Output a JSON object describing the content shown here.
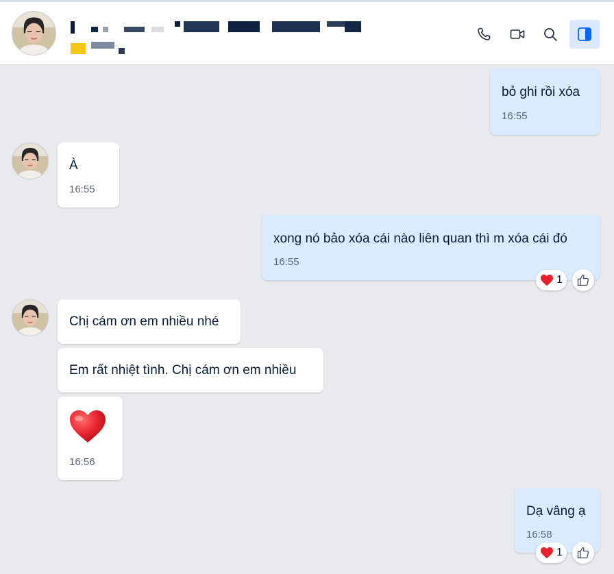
{
  "header": {
    "contact_name": "(blurred contact name)",
    "contact_status": "(blurred)"
  },
  "messages": [
    {
      "side": "out",
      "text": "bỏ ghi rồi xóa",
      "time": "16:55"
    },
    {
      "side": "in",
      "text": "À",
      "time": "16:55"
    },
    {
      "side": "out",
      "text": "xong nó bảo xóa cái nào liên quan thì m xóa cái đó",
      "time": "16:55",
      "reaction": {
        "icon": "heart",
        "count": "1"
      }
    },
    {
      "side": "in",
      "text": "Chị cám ơn em nhiều nhé"
    },
    {
      "side": "in",
      "text": "Em rất nhiệt tình. Chị cám ơn em nhiều"
    },
    {
      "side": "in",
      "sticker": "red-heart",
      "time": "16:56"
    },
    {
      "side": "out",
      "text": "Dạ vâng ạ",
      "time": "16:58",
      "reaction": {
        "icon": "heart",
        "count": "1"
      }
    }
  ],
  "colors": {
    "background": "#e9eaee",
    "incoming_bubble": "#ffffff",
    "outgoing_bubble": "#dbebff",
    "accent": "#0068ff",
    "heart": "#e5212c"
  }
}
